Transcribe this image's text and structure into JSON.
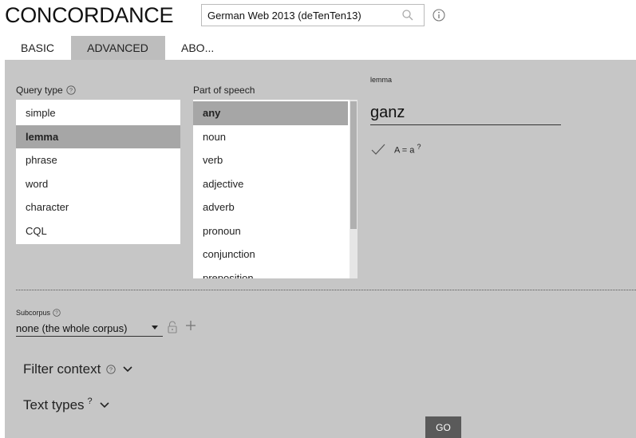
{
  "header": {
    "app_title": "CONCORDANCE",
    "corpus_value": "German Web 2013 (deTenTen13)"
  },
  "tabs": [
    {
      "label": "BASIC",
      "active": false
    },
    {
      "label": "ADVANCED",
      "active": true
    },
    {
      "label": "ABO...",
      "active": false
    }
  ],
  "query_type": {
    "label": "Query type",
    "options": [
      "simple",
      "lemma",
      "phrase",
      "word",
      "character",
      "CQL"
    ],
    "selected": "lemma"
  },
  "part_of_speech": {
    "label": "Part of speech",
    "options": [
      "any",
      "noun",
      "verb",
      "adjective",
      "adverb",
      "pronoun",
      "conjunction",
      "preposition"
    ],
    "selected": "any"
  },
  "lemma": {
    "label": "lemma",
    "value": "ganz"
  },
  "case_option": {
    "label": "A = a",
    "sup": "?"
  },
  "subcorpus": {
    "label": "Subcorpus",
    "value": "none (the whole corpus)"
  },
  "filter_context": {
    "label": "Filter context"
  },
  "text_types": {
    "label": "Text types",
    "sup": "?"
  },
  "go_button": {
    "label": "GO"
  },
  "colors": {
    "panel_bg": "#c6c6c6",
    "selected_bg": "#a6a6a6",
    "go_bg": "#5a5a5a"
  }
}
